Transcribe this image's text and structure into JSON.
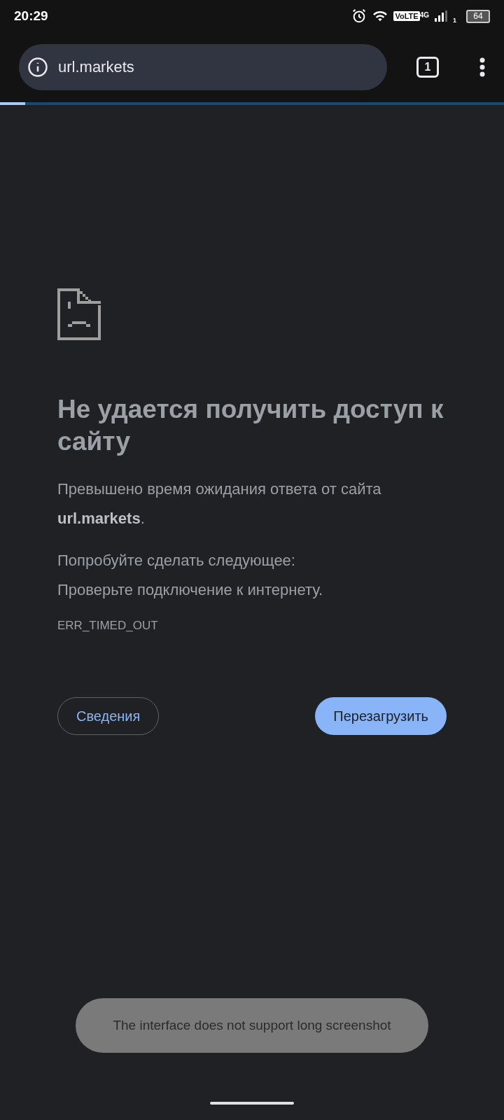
{
  "status_bar": {
    "time": "20:29",
    "volte": "VoLTE",
    "network": "4G",
    "sim": "1",
    "battery": "64"
  },
  "toolbar": {
    "url": "url.markets",
    "tab_count": "1"
  },
  "progress": {
    "level": 0.05
  },
  "error": {
    "title": "Не удается получить доступ к сайту",
    "message": "Превышено время ожидания ответа от сайта **url.markets**.",
    "suggestions": [
      "Попробуйте сделать следующее:",
      "Проверьте подключение к интернету."
    ],
    "code": "ERR_TIMED_OUT"
  },
  "buttons": [
    {
      "label": "Сведения",
      "kind": "outline"
    },
    {
      "label": "Перезагрузить",
      "kind": "filled"
    }
  ],
  "toast": {
    "text": "The interface does not support long screenshot"
  }
}
